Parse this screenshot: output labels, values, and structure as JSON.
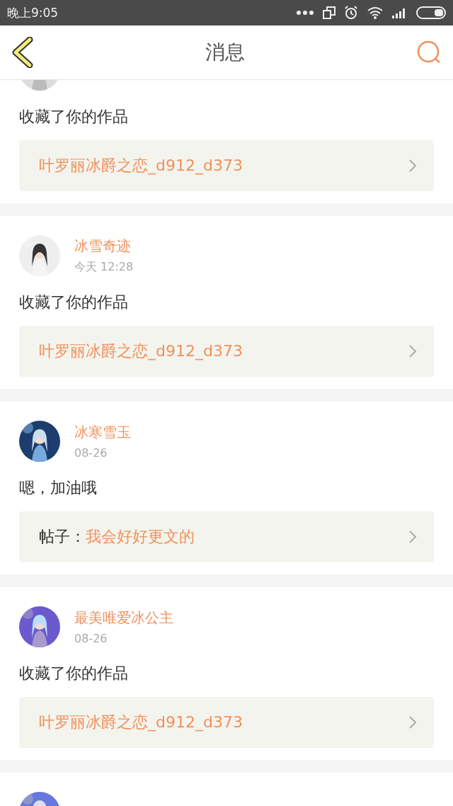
{
  "status_bar": {
    "time": "晚上9:05"
  },
  "header": {
    "title": "消息"
  },
  "messages": [
    {
      "avatar": {
        "kind": "picture"
      },
      "text": "收藏了你的作品",
      "target": {
        "kind": "work",
        "title": "叶罗丽冰爵之恋_d912_d373"
      }
    },
    {
      "avatar": {
        "kind": "picture"
      },
      "user": "冰雪奇迹",
      "time": "今天 12:28",
      "text": "收藏了你的作品",
      "target": {
        "kind": "work",
        "title": "叶罗丽冰爵之恋_d912_d373"
      }
    },
    {
      "avatar": {
        "kind": "picture"
      },
      "user": "冰寒雪玉",
      "time": "08-26",
      "text": "嗯，加油哦",
      "target": {
        "kind": "post",
        "prefix": "帖子：",
        "title": "我会好好更文的"
      }
    },
    {
      "avatar": {
        "kind": "picture"
      },
      "user": "最美唯爱冰公主",
      "time": "08-26",
      "text": "收藏了你的作品",
      "target": {
        "kind": "work",
        "title": "叶罗丽冰爵之恋_d912_d373"
      }
    },
    {
      "avatar": {
        "kind": "picture"
      }
    }
  ]
}
